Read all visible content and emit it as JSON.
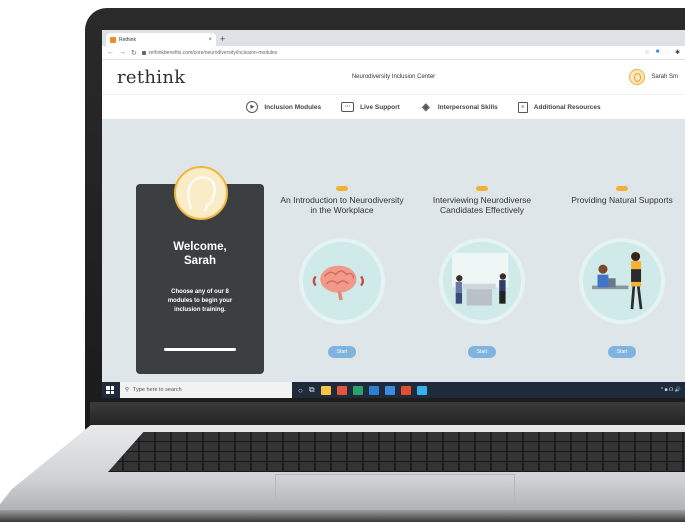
{
  "browser": {
    "tab_title": "Rethink",
    "tab_close": "×",
    "new_tab": "+",
    "url": "rethinkbenefits.com/core/neurodiversity/inclusion-modules"
  },
  "header": {
    "logo": "rethink",
    "center_title": "Neurodiversity Inclusion Center",
    "user_name": "Sarah Sm"
  },
  "nav": {
    "items": [
      {
        "label": "Inclusion Modules",
        "icon": "play-icon"
      },
      {
        "label": "Live Support",
        "icon": "chat-icon"
      },
      {
        "label": "Interpersonal Skills",
        "icon": "layers-icon"
      },
      {
        "label": "Additional Resources",
        "icon": "document-icon"
      }
    ]
  },
  "welcome": {
    "title": "Welcome, Sarah",
    "description": "Choose any of our 8 modules to begin your inclusion training."
  },
  "modules": [
    {
      "title": "An Introduction to Neurodiversity in the Workplace",
      "button": "Start",
      "illustration": "brain-icon"
    },
    {
      "title": "Interviewing Neurodiverse Candidates Effectively",
      "button": "Start",
      "illustration": "interview-illustration"
    },
    {
      "title": "Providing Natural Supports",
      "button": "Start",
      "illustration": "support-illustration"
    }
  ],
  "taskbar": {
    "search_placeholder": "Type here to search",
    "tray_text": "^ ■ ☊ 🔊"
  },
  "colors": {
    "accent": "#f3b236",
    "card_dark": "#3c3f41",
    "start_button": "#7fb4de",
    "circle_bg": "#cfeae8",
    "taskbar": "#1f2a3a"
  }
}
